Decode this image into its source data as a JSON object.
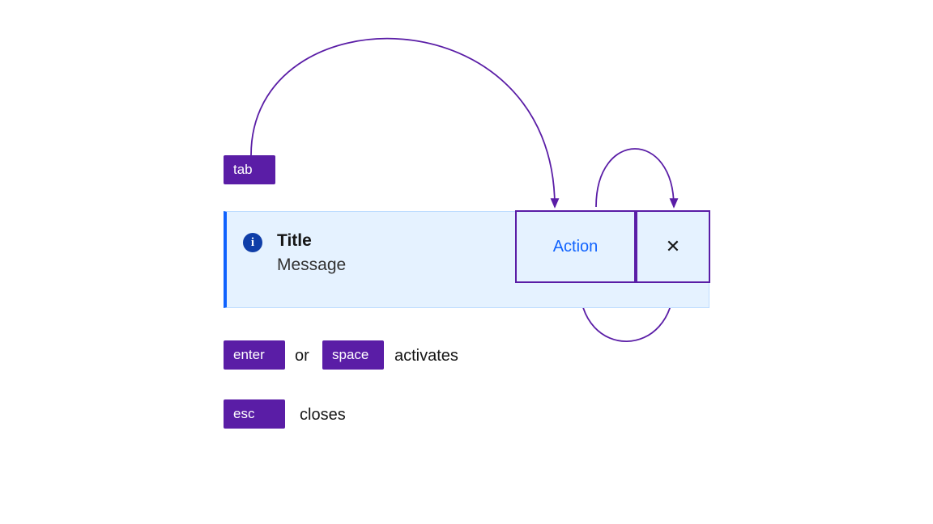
{
  "keys": {
    "tab": "tab",
    "enter": "enter",
    "space": "space",
    "esc": "esc"
  },
  "labels": {
    "or": "or",
    "activates": "activates",
    "closes": "closes"
  },
  "notification": {
    "title": "Title",
    "message": "Message",
    "action_label": "Action",
    "close_glyph": "✕"
  },
  "colors": {
    "key_bg": "#5a1da6",
    "notif_bg": "#e5f2ff",
    "accent": "#0f62fe",
    "arrow": "#5a1da6"
  }
}
